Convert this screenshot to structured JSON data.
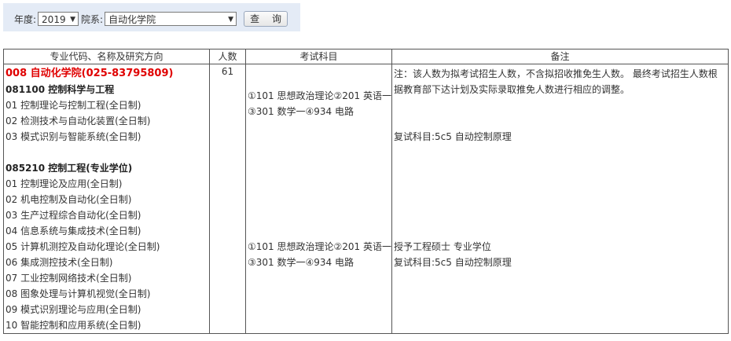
{
  "filter": {
    "year_label": "年度:",
    "year_value": "2019",
    "dept_label": "院系:",
    "dept_value": "自动化学院",
    "query_label": "查 询"
  },
  "table": {
    "headers": [
      "专业代码、名称及研究方向",
      "人数",
      "考试科目",
      "备注"
    ],
    "department": "008 自动化学院(025-83795809)",
    "count": "61",
    "majors": [
      {
        "title": "081100 控制科学与工程",
        "directions": [
          "01 控制理论与控制工程(全日制)",
          "02 检测技术与自动化装置(全日制)",
          "03 模式识别与智能系统(全日制)"
        ],
        "exam_line1": "①101 思想政治理论②201 英语一",
        "exam_line2": "③301 数学一④934 电路",
        "note": "注：该人数为拟考试招生人数，不含拟招收推免生人数。 最终考试招生人数根据教育部下达计划及实际录取推免人数进行相应的调整。",
        "retest": "复试科目:5c5 自动控制原理"
      },
      {
        "title": "085210 控制工程(专业学位)",
        "directions": [
          "01 控制理论及应用(全日制)",
          "02 机电控制及自动化(全日制)",
          "03 生产过程综合自动化(全日制)",
          "04 信息系统与集成技术(全日制)",
          "05 计算机测控及自动化理论(全日制)",
          "06 集成测控技术(全日制)",
          "07 工业控制网络技术(全日制)",
          "08 图象处理与计算机视觉(全日制)",
          "09 模式识别理论与应用(全日制)",
          "10 智能控制和应用系统(全日制)"
        ],
        "exam_line1": "①101 思想政治理论②201 英语一",
        "exam_line2": "③301 数学一④934 电路",
        "note": "授予工程硕士 专业学位",
        "retest": "复试科目:5c5 自动控制原理"
      }
    ]
  }
}
